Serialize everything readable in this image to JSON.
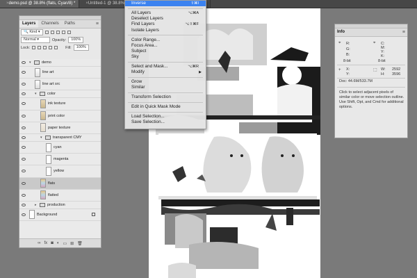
{
  "tabs": [
    {
      "label": "demo.psd @ 38.8% (flats, Cyan/8) *",
      "active": true
    },
    {
      "label": "Untitled-1 @ 38.8% (flats, Cyan/8) *",
      "active": false
    },
    {
      "label": "...8% (dots, CMYK/8)",
      "active": false
    }
  ],
  "layers_panel": {
    "tabs": [
      "Layers",
      "Channels",
      "Paths"
    ],
    "kind_filter": "Kind",
    "blend_mode": "Normal",
    "opacity_label": "Opacity:",
    "opacity_value": "100%",
    "lock_label": "Lock:",
    "fill_label": "Fill:",
    "fill_value": "100%",
    "layers": [
      {
        "name": "demo",
        "type": "group",
        "depth": 0,
        "expanded": true
      },
      {
        "name": "line art",
        "type": "layer",
        "depth": 1,
        "thumb": "lineart"
      },
      {
        "name": "line art src",
        "type": "layer",
        "depth": 1,
        "thumb": "lineart"
      },
      {
        "name": "color",
        "type": "group",
        "depth": 1,
        "expanded": true
      },
      {
        "name": "ink texture",
        "type": "layer",
        "depth": 2,
        "thumb": "tan"
      },
      {
        "name": "print color",
        "type": "layer",
        "depth": 2,
        "thumb": "tan"
      },
      {
        "name": "paper texture",
        "type": "layer",
        "depth": 2,
        "thumb": "paper"
      },
      {
        "name": "transparent CMY",
        "type": "group",
        "depth": 2,
        "expanded": true
      },
      {
        "name": "cyan",
        "type": "layer",
        "depth": 3,
        "thumb": "white"
      },
      {
        "name": "magenta",
        "type": "layer",
        "depth": 3,
        "thumb": "white"
      },
      {
        "name": "yellow",
        "type": "layer",
        "depth": 3,
        "thumb": "white"
      },
      {
        "name": "flats",
        "type": "layer",
        "depth": 2,
        "thumb": "color",
        "selected": true
      },
      {
        "name": "flatted",
        "type": "layer",
        "depth": 2,
        "thumb": "color"
      },
      {
        "name": "production",
        "type": "group",
        "depth": 1,
        "expanded": false
      },
      {
        "name": "Background",
        "type": "layer",
        "depth": 0,
        "thumb": "white",
        "locked": true
      }
    ]
  },
  "select_menu": {
    "items": [
      {
        "label": "Inverse",
        "shortcut": "⇧⌘I",
        "highlight": true
      },
      {
        "sep": true
      },
      {
        "label": "All Layers",
        "shortcut": "⌥⌘A"
      },
      {
        "label": "Deselect Layers",
        "shortcut": ""
      },
      {
        "label": "Find Layers",
        "shortcut": "⌥⇧⌘F"
      },
      {
        "label": "Isolate Layers",
        "shortcut": ""
      },
      {
        "sep": true
      },
      {
        "label": "Color Range...",
        "shortcut": ""
      },
      {
        "label": "Focus Area...",
        "shortcut": ""
      },
      {
        "label": "Subject",
        "shortcut": ""
      },
      {
        "label": "Sky",
        "shortcut": ""
      },
      {
        "sep": true
      },
      {
        "label": "Select and Mask...",
        "shortcut": "⌥⌘R"
      },
      {
        "label": "Modify",
        "shortcut": "",
        "submenu": true
      },
      {
        "sep": true
      },
      {
        "label": "Grow",
        "shortcut": ""
      },
      {
        "label": "Similar",
        "shortcut": ""
      },
      {
        "sep": true
      },
      {
        "label": "Transform Selection",
        "shortcut": ""
      },
      {
        "sep": true
      },
      {
        "label": "Edit in Quick Mask Mode",
        "shortcut": ""
      },
      {
        "sep": true
      },
      {
        "label": "Load Selection...",
        "shortcut": ""
      },
      {
        "label": "Save Selection...",
        "shortcut": ""
      }
    ]
  },
  "info_panel": {
    "title": "Info",
    "r_label": "R:",
    "g_label": "G:",
    "b_label": "B:",
    "bit_left": "8-bit",
    "cmyk_labels": "C:\nM:\nY:\nK:",
    "bit_right": "8-bit",
    "x_label": "X:",
    "y_label": "Y:",
    "w_label": "W:",
    "h_label": "H:",
    "w_value": "2592",
    "h_value": "3596",
    "doc_info": "Doc: 44.6M/533.7M",
    "hint": "Click to select adjacent pixels of similar color or move selection outline. Use Shift, Opt, and Cmd for additional options."
  }
}
